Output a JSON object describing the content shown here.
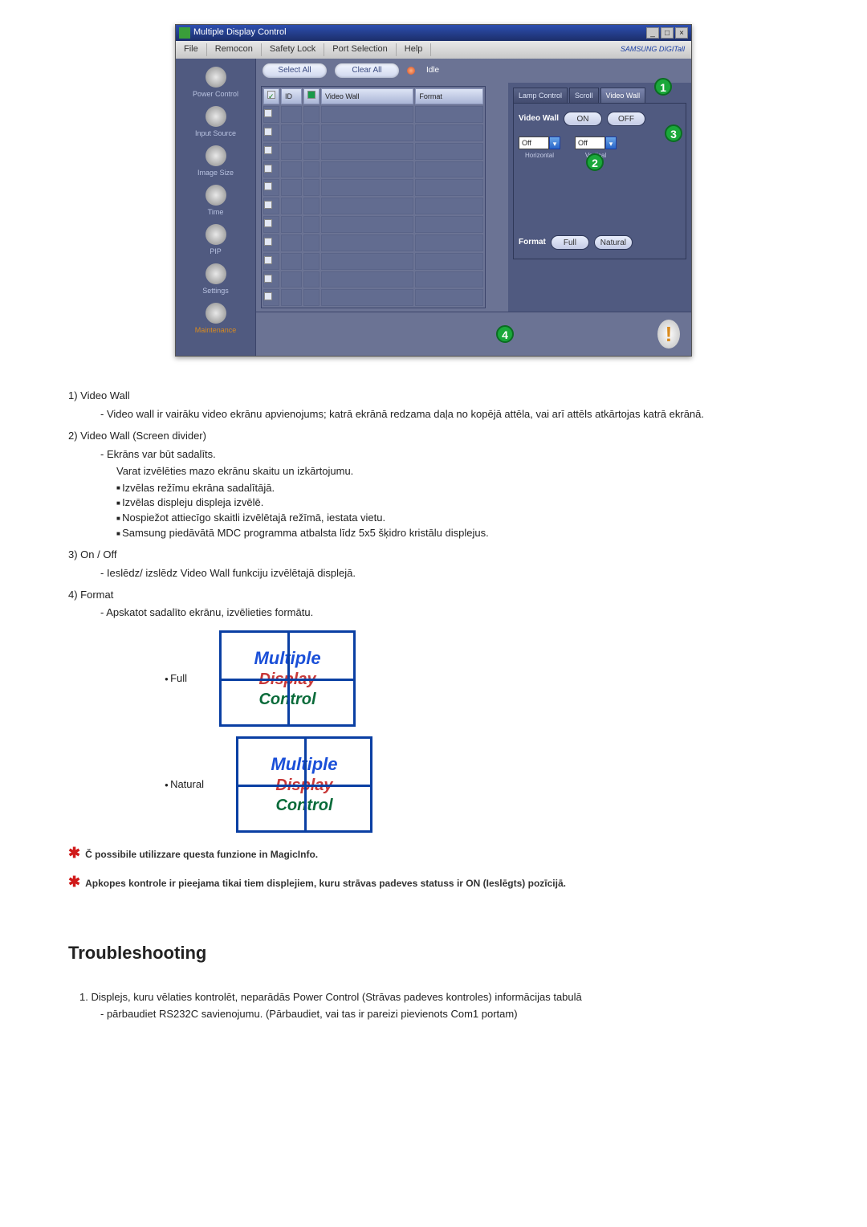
{
  "app": {
    "title": "Multiple Display Control",
    "win_btns": {
      "min": "_",
      "max": "□",
      "close": "×"
    },
    "menu": [
      "File",
      "Remocon",
      "Safety Lock",
      "Port Selection",
      "Help"
    ],
    "brand": "SAMSUNG DIGITall",
    "sidebar": [
      {
        "label": "Power Control"
      },
      {
        "label": "Input Source"
      },
      {
        "label": "Image Size"
      },
      {
        "label": "Time"
      },
      {
        "label": "PIP"
      },
      {
        "label": "Settings"
      },
      {
        "label": "Maintenance"
      }
    ],
    "toolbar": {
      "select_all": "Select All",
      "clear_all": "Clear All",
      "idle": "Idle"
    },
    "table_headers": [
      "",
      "ID",
      "",
      "Video Wall",
      "Format"
    ],
    "right": {
      "tabs": [
        "Lamp Control",
        "Scroll",
        "Video Wall"
      ],
      "video_wall_label": "Video Wall",
      "on": "ON",
      "off": "OFF",
      "h_value": "Off",
      "v_value": "Off",
      "h_label": "Horizontal",
      "v_label": "Vertical",
      "format_label": "Format",
      "full_btn": "Full",
      "natural_btn": "Natural"
    },
    "badges": {
      "b1": "1",
      "b2": "2",
      "b3": "3",
      "b4": "4"
    }
  },
  "content": {
    "i1_t": "1) Video Wall",
    "i1_s": "- Video wall ir vairāku video ekrānu apvienojums; katrā ekrānā redzama daļa no kopējā attēla, vai arī attēls atkārtojas katrā ekrānā.",
    "i2_t": "2)  Video Wall (Screen divider)",
    "i2_s1": "- Ekrāns var būt sadalīts.",
    "i2_s2": "Varat izvēlēties mazo ekrānu skaitu un izkārtojumu.",
    "i2_b": [
      "Izvēlas režīmu ekrāna sadalītājā.",
      "Izvēlas displeju displeja izvēlē.",
      "Nospiežot attiecīgo skaitli izvēlētajā režīmā, iestata vietu.",
      "Samsung piedāvātā MDC programma atbalsta līdz 5x5 šķidro kristālu displejus."
    ],
    "i3_t": "3)  On / Off",
    "i3_s": "- Ieslēdz/ izslēdz Video Wall funkciju izvēlētajā displejā.",
    "i4_t": "4)  Format",
    "i4_s": "- Apskatot sadalīto ekrānu, izvēlieties formātu.",
    "full_label": "Full",
    "natural_label": "Natural",
    "diag1": "Multiple",
    "diag2": "Display",
    "diag3": "Control",
    "star1": "Č possibile utilizzare questa funzione in MagicInfo.",
    "star2": "Apkopes kontrole ir pieejama tikai tiem displejiem, kuru strāvas padeves statuss ir ON (Ieslēgts) pozīcijā.",
    "troubleshooting": "Troubleshooting",
    "ts1": "1. Displejs, kuru vēlaties kontrolēt, neparādās Power Control (Strāvas padeves kontroles) informācijas tabulā",
    "ts1_s": "- pārbaudiet RS232C savienojumu. (Pārbaudiet, vai tas ir pareizi pievienots Com1 portam)"
  }
}
